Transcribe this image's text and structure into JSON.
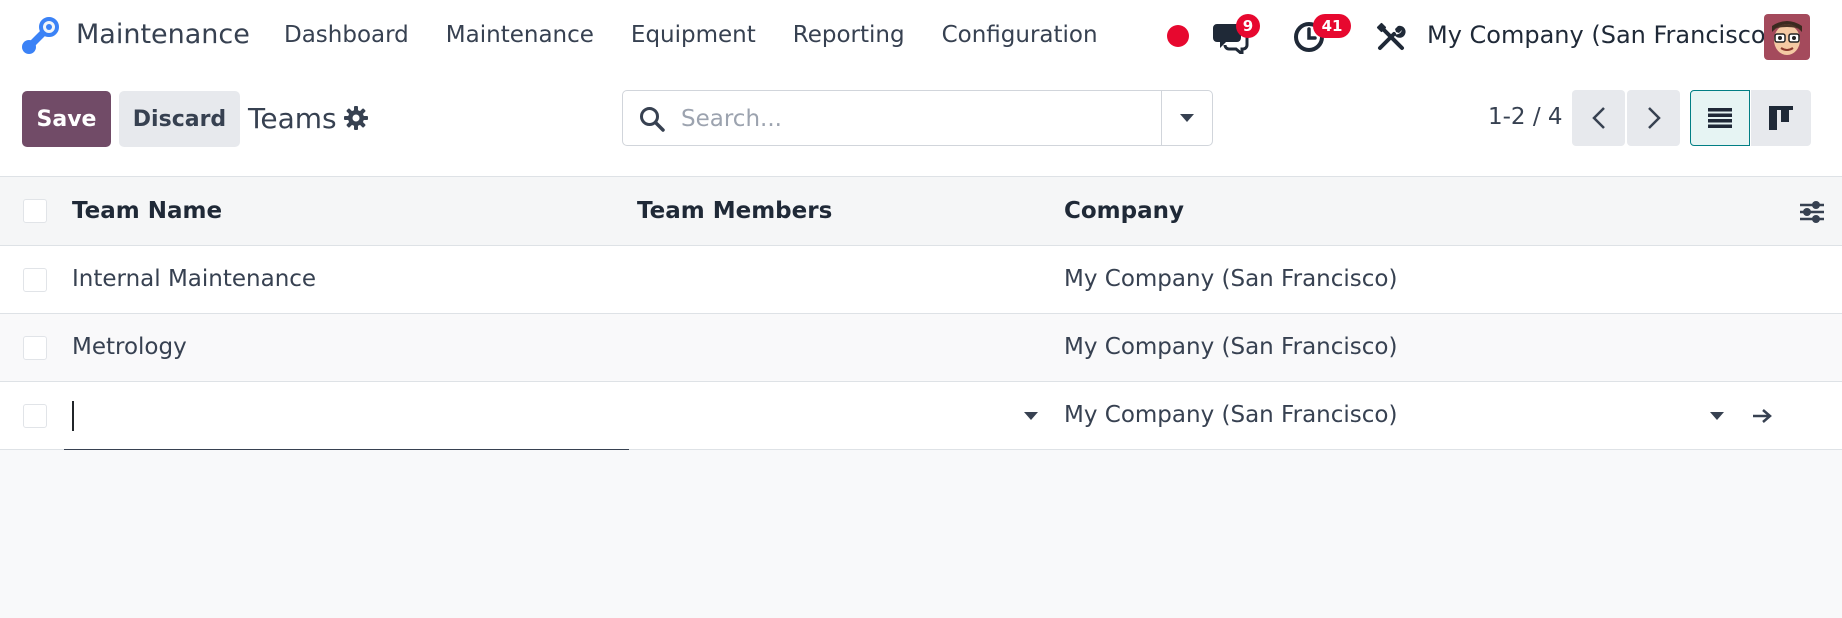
{
  "app": {
    "name": "Maintenance"
  },
  "menu": [
    "Dashboard",
    "Maintenance",
    "Equipment",
    "Reporting",
    "Configuration"
  ],
  "systray": {
    "messages_count": "9",
    "activities_count": "41",
    "company": "My Company (San Francisco)"
  },
  "toolbar": {
    "save_label": "Save",
    "discard_label": "Discard",
    "title": "Teams"
  },
  "search": {
    "placeholder": "Search..."
  },
  "pager": {
    "value": "1-2 / 4"
  },
  "table": {
    "headers": {
      "name": "Team Name",
      "members": "Team Members",
      "company": "Company"
    },
    "rows": [
      {
        "name": "Internal Maintenance",
        "members": "",
        "company": "My Company (San Francisco)"
      },
      {
        "name": "Metrology",
        "members": "",
        "company": "My Company (San Francisco)"
      }
    ],
    "new_row": {
      "name": "",
      "members": "",
      "company": "My Company (San Francisco)"
    }
  },
  "colors": {
    "brand": "#714b67",
    "accent": "#017e84",
    "badge": "#e7082f"
  }
}
